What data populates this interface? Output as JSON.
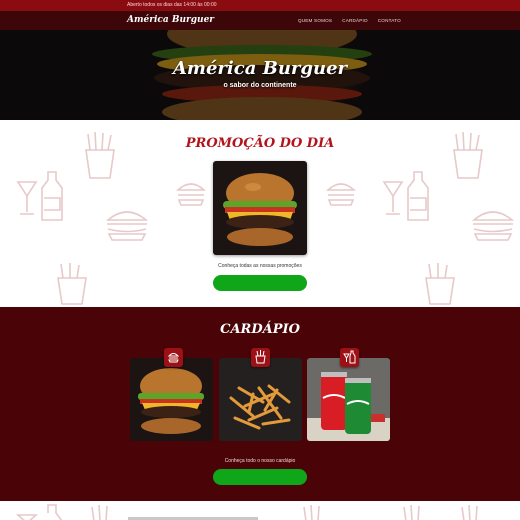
{
  "topbar": {
    "hours": "Aberto todos os dias das 14:00 às 00:00"
  },
  "nav": {
    "logo": "América Burguer",
    "links": [
      "QUEM SOMOS",
      "CARDÁPIO",
      "CONTATO"
    ]
  },
  "hero": {
    "title": "América Burguer",
    "subtitle": "o sabor do continente"
  },
  "promo": {
    "title": "PROMOÇÃO DO DIA",
    "image_icon": "burger-photo",
    "caption": "Conheça todas as nossas promoções"
  },
  "cardapio": {
    "title": "CARDÁPIO",
    "items": [
      {
        "photo": "burger-photo",
        "badge_icon": "burger-icon"
      },
      {
        "photo": "fries-photo",
        "badge_icon": "fries-icon"
      },
      {
        "photo": "soda-cans-photo",
        "badge_icon": "drinks-icon"
      }
    ],
    "caption": "Conheça todo o nosso cardápio"
  },
  "colors": {
    "topbar": "#8b0c10",
    "nav": "#3d0608",
    "section_dark": "#4a0306",
    "title_red": "#b3141b",
    "button_green": "#10a61a"
  }
}
